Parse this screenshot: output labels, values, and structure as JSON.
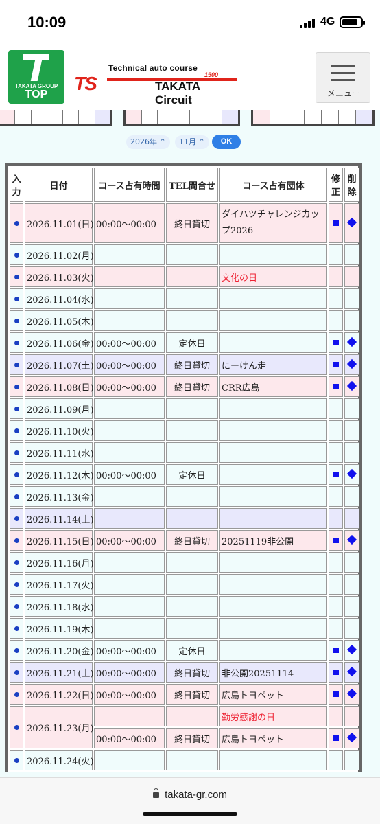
{
  "status": {
    "time": "10:09",
    "network": "4G"
  },
  "header": {
    "top_group": "TAKATA GROUP",
    "top_label": "TOP",
    "logo_line1": "Technical auto course",
    "logo_ts": "TS",
    "logo_num": "1500",
    "logo_line2": "TAKATA Circuit",
    "menu_label": "メニュー"
  },
  "selector": {
    "year": "2026年",
    "month": "11月",
    "ok": "OK"
  },
  "table": {
    "headers": [
      "入力",
      "日付",
      "コース占有時間",
      "TEL問合せ",
      "コース占有団体",
      "修正",
      "削除"
    ],
    "rows": [
      {
        "type": "sun",
        "date": "2026.11.01(日)",
        "time": "00:00〜00:00",
        "tel": "終日貸切",
        "org": "ダイハツチャレンジカップ2026",
        "edit": true,
        "del": true
      },
      {
        "type": "wk",
        "date": "2026.11.02(月)",
        "time": "",
        "tel": "",
        "org": "",
        "edit": false,
        "del": false
      },
      {
        "type": "sun",
        "date": "2026.11.03(火)",
        "time": "",
        "tel": "",
        "org": "文化の日",
        "org_red": true,
        "edit": false,
        "del": false
      },
      {
        "type": "wk",
        "date": "2026.11.04(水)",
        "time": "",
        "tel": "",
        "org": "",
        "edit": false,
        "del": false
      },
      {
        "type": "wk",
        "date": "2026.11.05(木)",
        "time": "",
        "tel": "",
        "org": "",
        "edit": false,
        "del": false
      },
      {
        "type": "wk",
        "date": "2026.11.06(金)",
        "time": "00:00〜00:00",
        "tel": "定休日",
        "org": "",
        "edit": true,
        "del": true
      },
      {
        "type": "sat",
        "date": "2026.11.07(土)",
        "time": "00:00〜00:00",
        "tel": "終日貸切",
        "org": "にーけん走",
        "edit": true,
        "del": true
      },
      {
        "type": "sun",
        "date": "2026.11.08(日)",
        "time": "00:00〜00:00",
        "tel": "終日貸切",
        "org": "CRR広島",
        "edit": true,
        "del": true
      },
      {
        "type": "wk",
        "date": "2026.11.09(月)",
        "time": "",
        "tel": "",
        "org": "",
        "edit": false,
        "del": false
      },
      {
        "type": "wk",
        "date": "2026.11.10(火)",
        "time": "",
        "tel": "",
        "org": "",
        "edit": false,
        "del": false
      },
      {
        "type": "wk",
        "date": "2026.11.11(水)",
        "time": "",
        "tel": "",
        "org": "",
        "edit": false,
        "del": false
      },
      {
        "type": "wk",
        "date": "2026.11.12(木)",
        "time": "00:00〜00:00",
        "tel": "定休日",
        "org": "",
        "edit": true,
        "del": true
      },
      {
        "type": "wk",
        "date": "2026.11.13(金)",
        "time": "",
        "tel": "",
        "org": "",
        "edit": false,
        "del": false
      },
      {
        "type": "sat",
        "date": "2026.11.14(土)",
        "time": "",
        "tel": "",
        "org": "",
        "edit": false,
        "del": false
      },
      {
        "type": "sun",
        "date": "2026.11.15(日)",
        "time": "00:00〜00:00",
        "tel": "終日貸切",
        "org": "20251119非公開",
        "edit": true,
        "del": true
      },
      {
        "type": "wk",
        "date": "2026.11.16(月)",
        "time": "",
        "tel": "",
        "org": "",
        "edit": false,
        "del": false
      },
      {
        "type": "wk",
        "date": "2026.11.17(火)",
        "time": "",
        "tel": "",
        "org": "",
        "edit": false,
        "del": false
      },
      {
        "type": "wk",
        "date": "2026.11.18(水)",
        "time": "",
        "tel": "",
        "org": "",
        "edit": false,
        "del": false
      },
      {
        "type": "wk",
        "date": "2026.11.19(木)",
        "time": "",
        "tel": "",
        "org": "",
        "edit": false,
        "del": false
      },
      {
        "type": "wk",
        "date": "2026.11.20(金)",
        "time": "00:00〜00:00",
        "tel": "定休日",
        "org": "",
        "edit": true,
        "del": true
      },
      {
        "type": "sat",
        "date": "2026.11.21(土)",
        "time": "00:00〜00:00",
        "tel": "終日貸切",
        "org": "非公開20251114",
        "edit": true,
        "del": true
      },
      {
        "type": "sun",
        "date": "2026.11.22(日)",
        "time": "00:00〜00:00",
        "tel": "終日貸切",
        "org": "広島トヨペット",
        "edit": true,
        "del": true
      }
    ],
    "row_23": {
      "date": "2026.11.23(月)",
      "holiday": "勤労感謝の日",
      "time": "00:00〜00:00",
      "tel": "終日貸切",
      "org": "広島トヨペット"
    },
    "row_24": {
      "date": "2026.11.24(火)"
    }
  },
  "browser": {
    "url": "takata-gr.com"
  }
}
